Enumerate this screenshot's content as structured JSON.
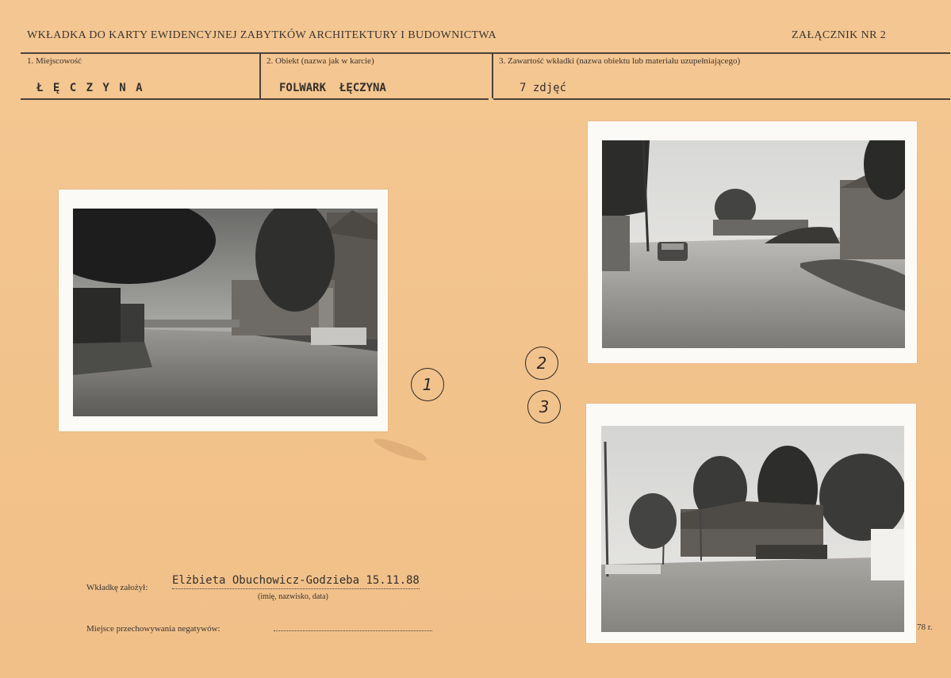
{
  "header": {
    "title": "WKŁADKA DO KARTY EWIDENCYJNEJ ZABYTKÓW ARCHITEKTURY I BUDOWNICTWA",
    "annex": "ZAŁĄCZNIK NR 2"
  },
  "fields": [
    {
      "label": "1. Miejscowość",
      "value": "Ł Ę C Z Y N A"
    },
    {
      "label": "2. Obiekt (nazwa jak w karcie)",
      "value": "FOLWARK  ŁĘCZYNA"
    },
    {
      "label": "3. Zawartość wkładki (nazwa obiektu lub materiału uzupełniającego)",
      "value": "7 zdjęć"
    }
  ],
  "photo_numbers": [
    "1",
    "2",
    "3"
  ],
  "footer": {
    "creator_label": "Wkładkę założył:",
    "creator_value": "Elżbieta Obuchowicz-Godzieba 15.11.88",
    "creator_caption": "(imię, nazwisko, data)",
    "negatives_label": "Miejsce przechowywania negatywów:",
    "year_suffix": "78 r."
  }
}
